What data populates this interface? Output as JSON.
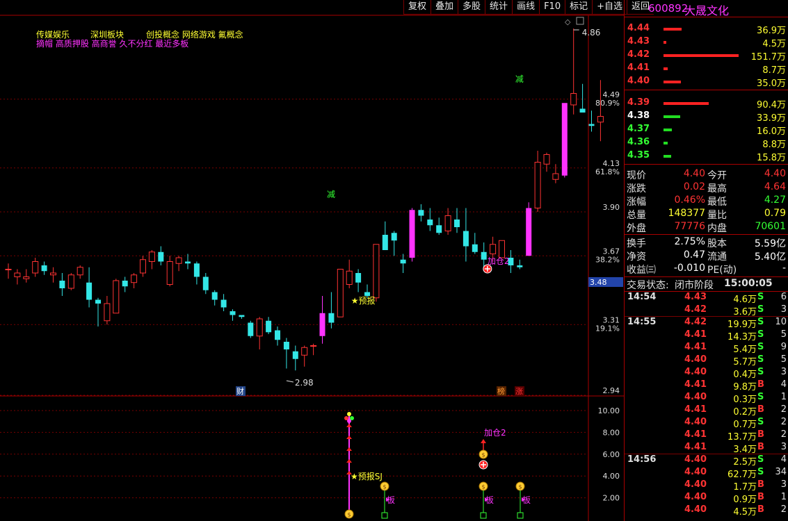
{
  "toolbar": [
    "复权",
    "叠加",
    "多股",
    "统计",
    "画线",
    "F10",
    "标记",
    "+自选",
    "返回"
  ],
  "stock": {
    "code": "600892",
    "name": "大晟文化"
  },
  "concepts": {
    "line1": [
      "传媒娱乐",
      "深圳板块",
      "创投概念 网络游戏 氟概念"
    ],
    "line2": "摘帽 高质押股 高商誉 久不分红 最近多板"
  },
  "axis_main": [
    {
      "price": "4.49",
      "pct": "80.9%"
    },
    {
      "price": "4.13",
      "pct": "61.8%"
    },
    {
      "price": "3.90",
      "pct": ""
    },
    {
      "price": "3.67",
      "pct": "38.2%"
    },
    {
      "price": "3.31",
      "pct": "19.1%"
    },
    {
      "price": "2.94",
      "pct": ""
    }
  ],
  "axis_sub": [
    "10.00",
    "8.00",
    "6.00",
    "4.00",
    "2.00"
  ],
  "cursor_price": "3.48",
  "annotations": {
    "high": "4.86",
    "low": "2.98",
    "jian1": "减",
    "jian2": "减",
    "yubao": "★预报",
    "jiacang": "加仓2",
    "cai": "财",
    "bang": "榜",
    "zhang": "涨",
    "sub_yubao": "★预报SJ",
    "sub_jiacang": "加仓2",
    "ban": "板"
  },
  "orderbook": {
    "asks": [
      {
        "price": "4.44",
        "vol": "36.9万",
        "w": 0.24
      },
      {
        "price": "4.43",
        "vol": "4.5万",
        "w": 0.03
      },
      {
        "price": "4.42",
        "vol": "151.7万",
        "w": 1.0
      },
      {
        "price": "4.41",
        "vol": "8.7万",
        "w": 0.06
      },
      {
        "price": "4.40",
        "vol": "35.0万",
        "w": 0.23
      }
    ],
    "bids": [
      {
        "price": "4.39",
        "vol": "90.4万",
        "w": 0.6,
        "color": "#ff3333"
      },
      {
        "price": "4.38",
        "vol": "33.9万",
        "w": 0.22,
        "color": "#ffffff"
      },
      {
        "price": "4.37",
        "vol": "16.0万",
        "w": 0.11,
        "color": "#33ff33"
      },
      {
        "price": "4.36",
        "vol": "8.8万",
        "w": 0.06,
        "color": "#33ff33"
      },
      {
        "price": "4.35",
        "vol": "15.8万",
        "w": 0.1,
        "color": "#33ff33"
      }
    ]
  },
  "quote": [
    {
      "l1": "现价",
      "v1": "4.40",
      "c1": "red",
      "l2": "今开",
      "v2": "4.40",
      "c2": "red"
    },
    {
      "l1": "涨跌",
      "v1": "0.02",
      "c1": "red",
      "l2": "最高",
      "v2": "4.64",
      "c2": "red"
    },
    {
      "l1": "涨幅",
      "v1": "0.46%",
      "c1": "red",
      "l2": "最低",
      "v2": "4.27",
      "c2": "green"
    },
    {
      "l1": "总量",
      "v1": "148377",
      "c1": "yellow",
      "l2": "量比",
      "v2": "0.79",
      "c2": "yellow"
    },
    {
      "l1": "外盘",
      "v1": "77776",
      "c1": "red",
      "l2": "内盘",
      "v2": "70601",
      "c2": "green"
    }
  ],
  "quote2": [
    {
      "l1": "换手",
      "v1": "2.75%",
      "c1": "white",
      "l2": "股本",
      "v2": "5.59亿",
      "c2": "white"
    },
    {
      "l1": "净资",
      "v1": "0.47",
      "c1": "white",
      "l2": "流通",
      "v2": "5.40亿",
      "c2": "white"
    },
    {
      "l1": "收益㈢",
      "v1": "-0.010",
      "c1": "white",
      "l2": "PE(动)",
      "v2": "-",
      "c2": "white"
    }
  ],
  "trade_status": {
    "label": "交易状态:",
    "value": "闭市阶段",
    "time": "15:00:05"
  },
  "trades": [
    {
      "t": "14:54",
      "p": "4.43",
      "v": "4.6万",
      "s": "S",
      "n": "6"
    },
    {
      "t": "",
      "p": "4.42",
      "v": "3.6万",
      "s": "S",
      "n": "3"
    },
    {
      "t": "14:55",
      "p": "4.42",
      "v": "19.9万",
      "s": "S",
      "n": "10"
    },
    {
      "t": "",
      "p": "4.41",
      "v": "14.3万",
      "s": "S",
      "n": "5"
    },
    {
      "t": "",
      "p": "4.41",
      "v": "5.4万",
      "s": "S",
      "n": "9"
    },
    {
      "t": "",
      "p": "4.40",
      "v": "5.7万",
      "s": "S",
      "n": "5"
    },
    {
      "t": "",
      "p": "4.40",
      "v": "0.4万",
      "s": "S",
      "n": "3"
    },
    {
      "t": "",
      "p": "4.41",
      "v": "9.8万",
      "s": "B",
      "n": "4"
    },
    {
      "t": "",
      "p": "4.40",
      "v": "0.3万",
      "s": "S",
      "n": "1"
    },
    {
      "t": "",
      "p": "4.41",
      "v": "0.2万",
      "s": "B",
      "n": "2"
    },
    {
      "t": "",
      "p": "4.40",
      "v": "0.7万",
      "s": "S",
      "n": "2"
    },
    {
      "t": "",
      "p": "4.41",
      "v": "13.7万",
      "s": "B",
      "n": "2"
    },
    {
      "t": "",
      "p": "4.41",
      "v": "3.4万",
      "s": "B",
      "n": "3"
    },
    {
      "t": "14:56",
      "p": "4.40",
      "v": "2.5万",
      "s": "S",
      "n": "4"
    },
    {
      "t": "",
      "p": "4.40",
      "v": "62.7万",
      "s": "S",
      "n": "34"
    },
    {
      "t": "",
      "p": "4.40",
      "v": "1.7万",
      "s": "B",
      "n": "3"
    },
    {
      "t": "",
      "p": "4.40",
      "v": "0.9万",
      "s": "B",
      "n": "1"
    },
    {
      "t": "",
      "p": "4.40",
      "v": "4.5万",
      "s": "B",
      "n": "2"
    }
  ],
  "chart_data": {
    "type": "candlestick",
    "ylim": [
      2.94,
      4.9
    ],
    "series": [
      {
        "name": "K",
        "values": [
          [
            3.6,
            3.63,
            3.55,
            3.6
          ],
          [
            3.56,
            3.6,
            3.52,
            3.58
          ],
          [
            3.55,
            3.6,
            3.53,
            3.56
          ],
          [
            3.58,
            3.66,
            3.56,
            3.64
          ],
          [
            3.62,
            3.64,
            3.57,
            3.59
          ],
          [
            3.57,
            3.61,
            3.53,
            3.58
          ],
          [
            3.54,
            3.58,
            3.46,
            3.5
          ],
          [
            3.5,
            3.58,
            3.49,
            3.57
          ],
          [
            3.57,
            3.62,
            3.55,
            3.61
          ],
          [
            3.53,
            3.61,
            3.4,
            3.44
          ],
          [
            3.44,
            3.45,
            3.3,
            3.42
          ],
          [
            3.33,
            3.46,
            3.31,
            3.42
          ],
          [
            3.37,
            3.55,
            3.37,
            3.54
          ],
          [
            3.54,
            3.56,
            3.48,
            3.51
          ],
          [
            3.53,
            3.58,
            3.5,
            3.57
          ],
          [
            3.58,
            3.67,
            3.56,
            3.65
          ],
          [
            3.64,
            3.7,
            3.6,
            3.69
          ],
          [
            3.69,
            3.72,
            3.62,
            3.64
          ],
          [
            3.52,
            3.67,
            3.51,
            3.64
          ],
          [
            3.63,
            3.67,
            3.59,
            3.66
          ],
          [
            3.64,
            3.68,
            3.6,
            3.63
          ],
          [
            3.63,
            3.64,
            3.52,
            3.56
          ],
          [
            3.56,
            3.58,
            3.47,
            3.49
          ],
          [
            3.48,
            3.49,
            3.41,
            3.44
          ],
          [
            3.44,
            3.47,
            3.38,
            3.4
          ],
          [
            3.38,
            3.39,
            3.33,
            3.36
          ],
          [
            3.36,
            3.36,
            3.34,
            3.35
          ],
          [
            3.32,
            3.33,
            3.24,
            3.25
          ],
          [
            3.25,
            3.35,
            3.18,
            3.34
          ],
          [
            3.33,
            3.35,
            3.26,
            3.27
          ],
          [
            3.28,
            3.3,
            3.2,
            3.23
          ],
          [
            3.22,
            3.24,
            3.08,
            3.18
          ],
          [
            3.17,
            3.2,
            3.07,
            3.13
          ],
          [
            3.15,
            3.2,
            3.09,
            3.19
          ],
          [
            3.2,
            3.21,
            3.15,
            3.2
          ],
          [
            3.25,
            3.46,
            3.21,
            3.37
          ],
          [
            3.37,
            3.48,
            3.29,
            3.32
          ],
          [
            3.35,
            3.4,
            3.35,
            3.6
          ],
          [
            3.52,
            3.65,
            3.5,
            3.59
          ],
          [
            3.58,
            3.6,
            3.48,
            3.53
          ],
          [
            3.48,
            3.52,
            3.45,
            3.46
          ],
          [
            3.45,
            3.72,
            3.43,
            3.73
          ],
          [
            3.78,
            3.85,
            3.71,
            3.7
          ],
          [
            3.79,
            3.8,
            3.67,
            3.75
          ],
          [
            3.65,
            3.68,
            3.58,
            3.63
          ],
          [
            3.66,
            3.92,
            3.64,
            3.91
          ],
          [
            3.91,
            3.94,
            3.85,
            3.88
          ],
          [
            3.86,
            3.92,
            3.8,
            3.83
          ],
          [
            3.83,
            3.87,
            3.78,
            3.79
          ],
          [
            3.8,
            3.92,
            3.78,
            3.88
          ],
          [
            3.86,
            3.92,
            3.79,
            3.82
          ],
          [
            3.8,
            3.92,
            3.64,
            3.72
          ],
          [
            3.73,
            3.79,
            3.68,
            3.69
          ],
          [
            3.69,
            3.74,
            3.6,
            3.65
          ],
          [
            3.68,
            3.77,
            3.64,
            3.73
          ],
          [
            3.66,
            3.74,
            3.66,
            3.75
          ],
          [
            3.66,
            3.7,
            3.58,
            3.62
          ],
          [
            3.62,
            3.65,
            3.6,
            3.61
          ],
          [
            3.67,
            3.95,
            3.67,
            3.92
          ],
          [
            3.92,
            4.22,
            3.9,
            4.16
          ],
          [
            4.15,
            4.21,
            4.11,
            4.2
          ],
          [
            4.07,
            4.15,
            4.05,
            4.1
          ],
          [
            4.09,
            4.42,
            4.08,
            4.47
          ],
          [
            4.46,
            4.86,
            4.41,
            4.52
          ],
          [
            4.44,
            4.57,
            4.42,
            4.42
          ],
          [
            4.36,
            4.43,
            4.32,
            4.35
          ],
          [
            4.37,
            4.59,
            4.27,
            4.4
          ]
        ]
      }
    ]
  }
}
